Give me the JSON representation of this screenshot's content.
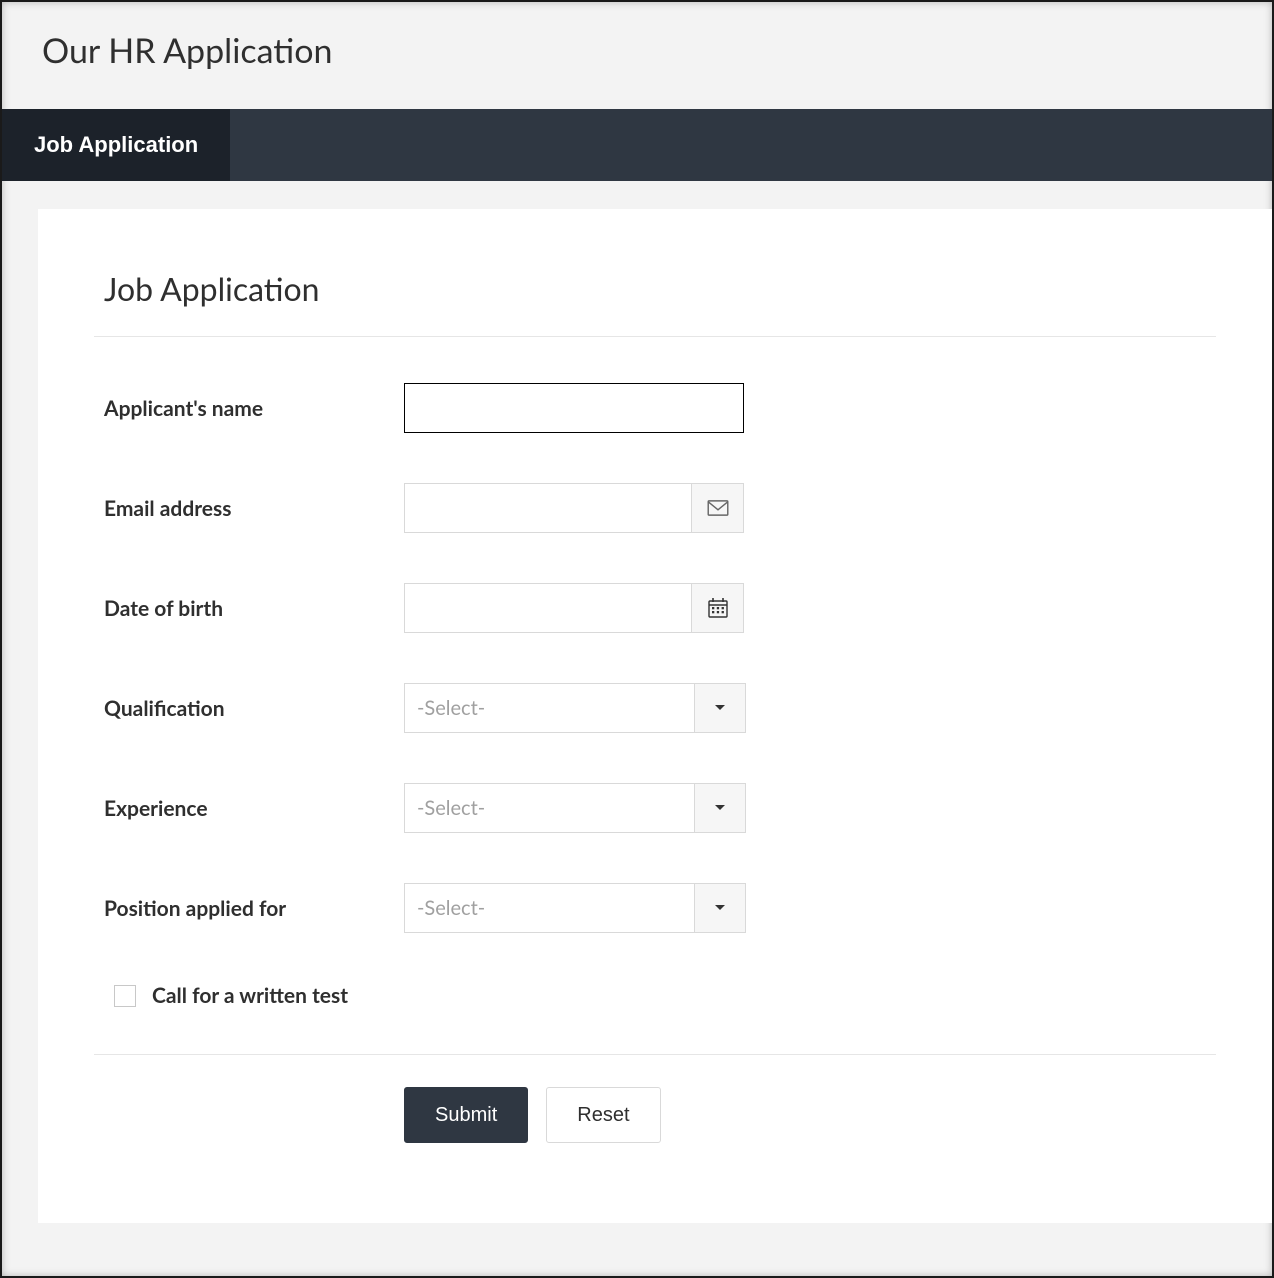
{
  "header": {
    "title": "Our HR Application"
  },
  "nav": {
    "tab1": "Job Application"
  },
  "card": {
    "title": "Job Application"
  },
  "form": {
    "applicant_name": {
      "label": "Applicant's name",
      "value": ""
    },
    "email": {
      "label": "Email address",
      "value": ""
    },
    "dob": {
      "label": "Date of birth",
      "value": ""
    },
    "qualification": {
      "label": "Qualification",
      "placeholder": "-Select-"
    },
    "experience": {
      "label": "Experience",
      "placeholder": "-Select-"
    },
    "position": {
      "label": "Position applied for",
      "placeholder": "-Select-"
    },
    "written_test": {
      "label": "Call for a written test",
      "checked": false
    }
  },
  "buttons": {
    "submit": "Submit",
    "reset": "Reset"
  }
}
